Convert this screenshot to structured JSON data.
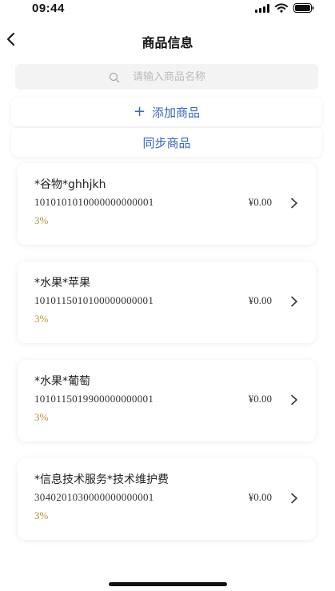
{
  "status_bar": {
    "time": "09:44"
  },
  "nav": {
    "title": "商品信息"
  },
  "search": {
    "placeholder": "请输入商品名称",
    "value": ""
  },
  "actions": {
    "add_label": "添加商品",
    "sync_label": "同步商品"
  },
  "products": [
    {
      "name": "*谷物*ghhjkh",
      "code": "1010101010000000000001",
      "price": "¥0.00",
      "tax": "3%"
    },
    {
      "name": "*水果*苹果",
      "code": "1010115010100000000001",
      "price": "¥0.00",
      "tax": "3%"
    },
    {
      "name": "*水果*葡萄",
      "code": "1010115019900000000001",
      "price": "¥0.00",
      "tax": "3%"
    },
    {
      "name": "*信息技术服务*技术维护费",
      "code": "3040201030000000000001",
      "price": "¥0.00",
      "tax": "3%"
    }
  ],
  "colors": {
    "accent": "#3a67b8",
    "tax": "#b8923a",
    "search_bg": "#f3f3f3"
  }
}
